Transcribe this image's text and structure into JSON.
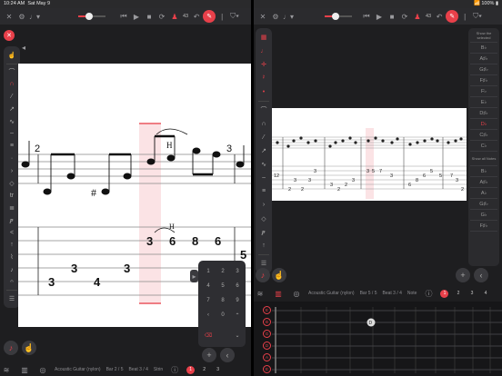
{
  "status": {
    "time": "10:24 AM",
    "date": "Sat May 9",
    "battery": "100%"
  },
  "tempo": "43",
  "left": {
    "bottom": {
      "instrument": "Acoustic Guitar (nylon)",
      "bar": "Bar 2 / 5",
      "beat": "Beat 3 / 4",
      "string": "Strin",
      "pages": [
        "1",
        "2",
        "3"
      ]
    },
    "notation": {
      "bar_numbers": [
        "2",
        "3"
      ],
      "hammer": "H",
      "tab_numbers": [
        "3",
        "3",
        "4",
        "3",
        "3",
        "6",
        "8",
        "6",
        "5"
      ],
      "sharp": "#"
    },
    "keypad": [
      "1",
      "2",
      "3",
      "4",
      "5",
      "6",
      "7",
      "8",
      "9",
      "0"
    ]
  },
  "right": {
    "bottom": {
      "instrument": "Acoustic Guitar (nylon)",
      "bar": "Bar 5 / 5",
      "beat": "Beat 3 / 4",
      "note": "Note",
      "pages": [
        "1",
        "2",
        "3",
        "4"
      ]
    },
    "notes": [
      {
        "label": "Show the selected",
        "small": true
      },
      {
        "label": "B♭"
      },
      {
        "label": "A♯♭"
      },
      {
        "label": "G♯♭"
      },
      {
        "label": "F♯♭"
      },
      {
        "label": "F♭"
      },
      {
        "label": "E♭"
      },
      {
        "label": "D♯♭"
      },
      {
        "label": "D♭",
        "red": true
      },
      {
        "label": "C♯♭"
      },
      {
        "label": "C♭"
      },
      {
        "label": "Show all Notes",
        "small": true
      },
      {
        "label": "B♭"
      },
      {
        "label": "A♯♭"
      },
      {
        "label": "A♭"
      },
      {
        "label": "G♯♭"
      },
      {
        "label": "G♭"
      },
      {
        "label": "F♯♭"
      }
    ],
    "strings": [
      "E",
      "B",
      "G",
      "D",
      "A",
      "E"
    ],
    "fret_marker": "D",
    "tab_small": [
      "12",
      "2",
      "3",
      "2",
      "3",
      "3",
      "3",
      "2",
      "2",
      "3",
      "3",
      "5",
      "7",
      "3",
      "6",
      "8",
      "6",
      "5",
      "5",
      "7",
      "3",
      "2"
    ]
  }
}
